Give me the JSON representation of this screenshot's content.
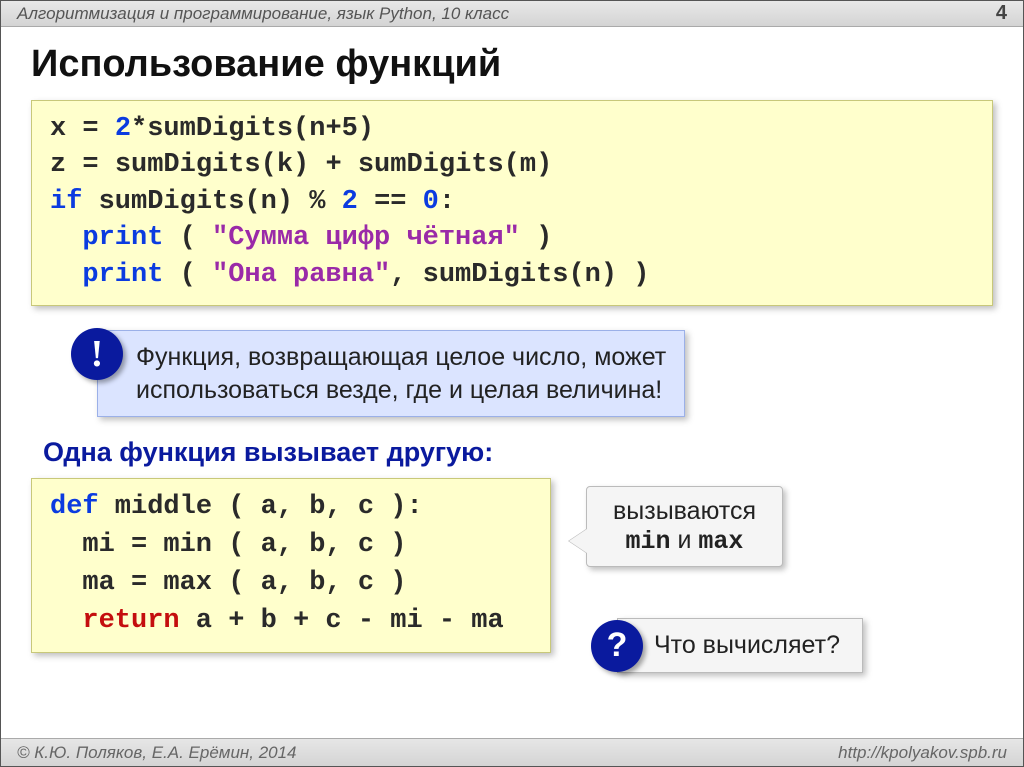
{
  "header": {
    "course": "Алгоритмизация и программирование, язык Python, 10 класс",
    "page": "4"
  },
  "title": "Использование функций",
  "code1": {
    "l1_a": "x",
    "l1_eq": "=",
    "l1_two": "2",
    "l1_b": "*sumDigits(n+5)",
    "l2_a": "z",
    "l2_eq": "=",
    "l2_b": "sumDigits(k)",
    "l2_plus": "+",
    "l2_c": "sumDigits(m)",
    "l3_if": "if",
    "l3_a": " sumDigits(n)",
    "l3_pct": "%",
    "l3_two": "2",
    "l3_eqeq": "==",
    "l3_zero": "0",
    "l3_colon": ":",
    "l4_print": "print",
    "l4_open": " ( ",
    "l4_str": "\"Сумма цифр чётная\"",
    "l4_close": " )",
    "l5_print": "print",
    "l5_open": " ( ",
    "l5_str": "\"Она равна\"",
    "l5_comma": ", sumDigits(n) )"
  },
  "note": {
    "badge": "!",
    "text_a": "Функция, возвращающая целое число, может",
    "text_b": "использоваться везде, где и целая величина!"
  },
  "subheading": "Одна функция вызывает другую:",
  "code2": {
    "l1_def": "def",
    "l1_rest": " middle ( a, b, c ):",
    "l2": "mi",
    "l2_eq": "=",
    "l2_b": "min ( a, b, c )",
    "l3": "ma",
    "l3_eq": "=",
    "l3_b": "max ( a, b, c )",
    "l4_ret": "return",
    "l4_rest": " a + b + c - mi - ma"
  },
  "callout": {
    "line1": "вызываются",
    "min": "min",
    "and": " и ",
    "max": "max"
  },
  "question": {
    "badge": "?",
    "text": "Что вычисляет?"
  },
  "footer": {
    "authors": "© К.Ю. Поляков, Е.А. Ерёмин, 2014",
    "url": "http://kpolyakov.spb.ru"
  }
}
